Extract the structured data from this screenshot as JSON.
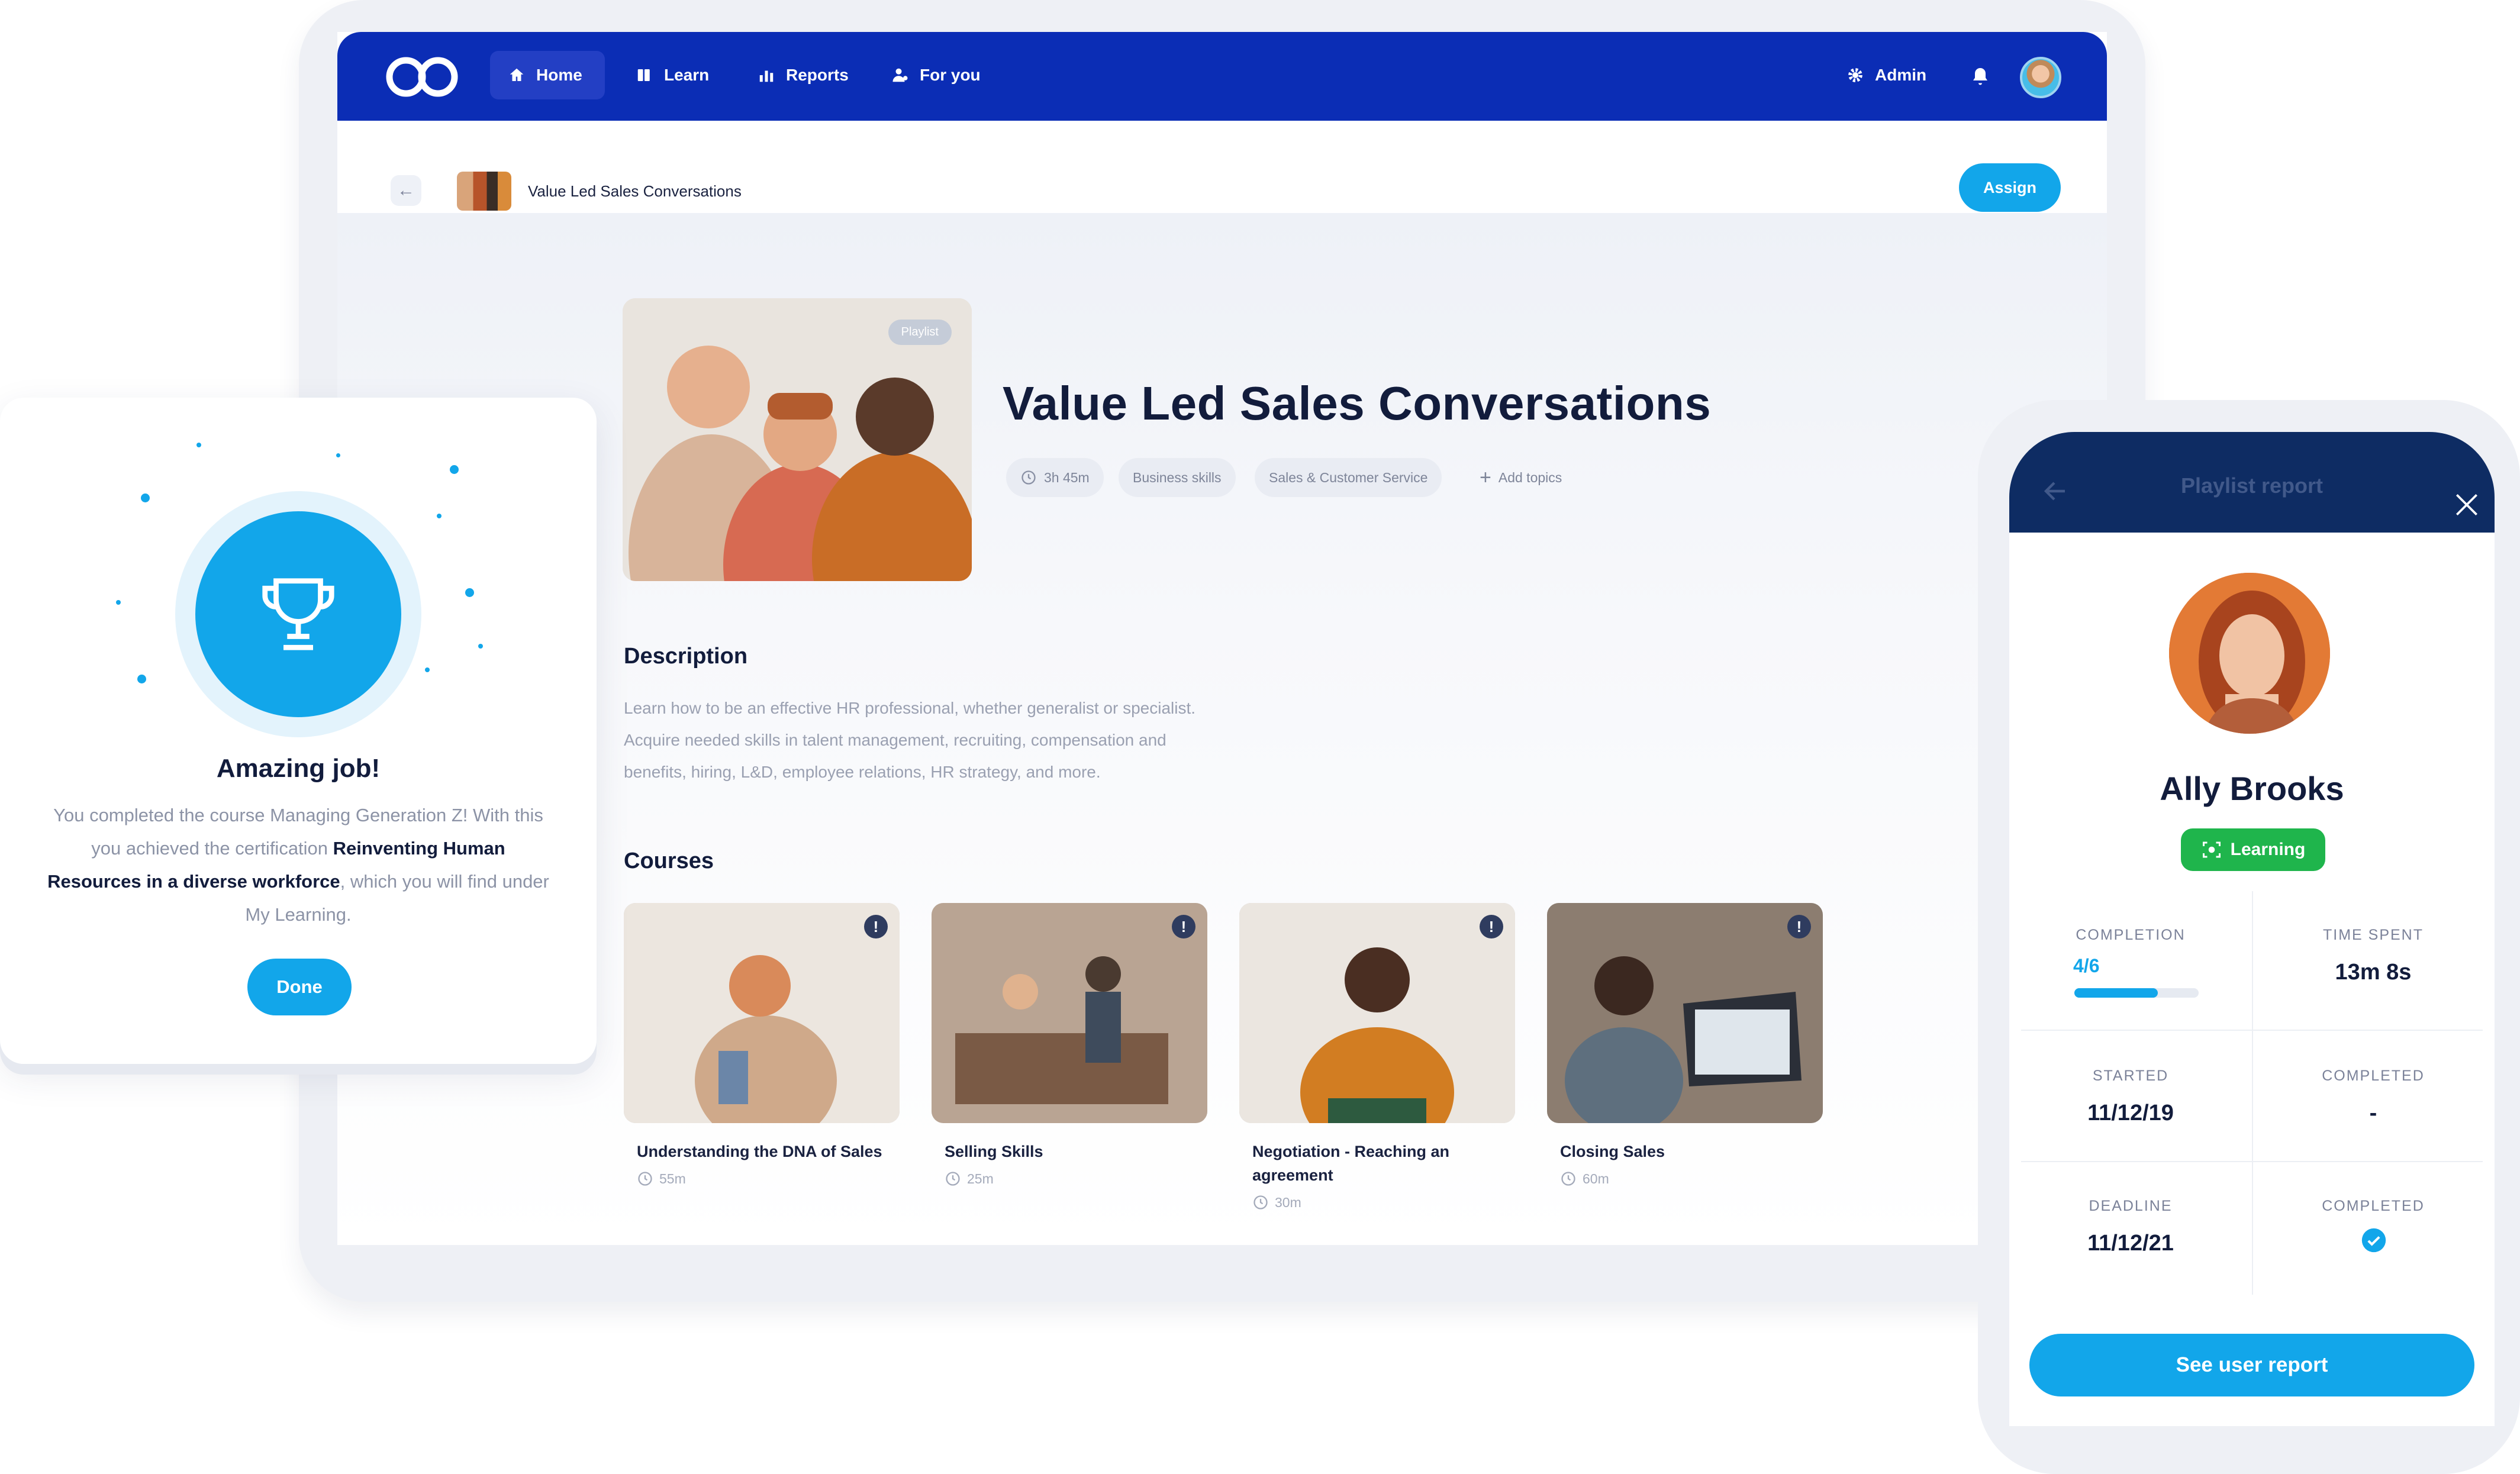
{
  "nav": {
    "items": [
      {
        "label": "Home",
        "icon": "home-icon"
      },
      {
        "label": "Learn",
        "icon": "learn-icon"
      },
      {
        "label": "Reports",
        "icon": "bar-chart-icon"
      },
      {
        "label": "For you",
        "icon": "person-star-icon"
      }
    ],
    "admin_label": "Admin"
  },
  "breadcrumb": {
    "title": "Value Led Sales Conversations",
    "assign_label": "Assign"
  },
  "playlist": {
    "badge": "Playlist",
    "title": "Value Led Sales Conversations",
    "duration": "3h 45m",
    "tags": [
      "Business skills",
      "Sales & Customer Service"
    ],
    "add_topics": "Add topics"
  },
  "description": {
    "heading": "Description",
    "lines": [
      "Learn how to be an effective HR professional, whether generalist or specialist.",
      "Acquire needed skills in talent management, recruiting, compensation and",
      "benefits, hiring, L&D, employee relations, HR strategy, and more."
    ]
  },
  "courses": {
    "heading": "Courses",
    "items": [
      {
        "title": "Understanding the DNA of Sales",
        "duration": "55m"
      },
      {
        "title": "Selling Skills",
        "duration": "25m"
      },
      {
        "title": "Negotiation - Reaching an agreement",
        "duration": "30m"
      },
      {
        "title": "Closing Sales",
        "duration": "60m"
      }
    ]
  },
  "popup": {
    "title": "Amazing job!",
    "text_1": "You completed the course Managing Generation Z! With this you achieved the certification ",
    "text_bold": "Reinventing Human Resources in a diverse workforce",
    "text_2": ", which you will find under My Learning.",
    "done_label": "Done"
  },
  "phone": {
    "header_title": "Playlist report",
    "name": "Ally Brooks",
    "status": "Learning",
    "completion_label": "COMPLETION",
    "completion_value": "4/6",
    "completion_fraction": 0.67,
    "time_spent_label": "TIME SPENT",
    "time_spent_value": "13m 8s",
    "started_label": "STARTED",
    "started_value": "11/12/19",
    "completed_label": "COMPLETED",
    "completed_value": "-",
    "deadline_label": "DEADLINE",
    "deadline_value": "11/12/21",
    "completed2_label": "COMPLETED",
    "button_label": "See user report"
  },
  "colors": {
    "primary": "#12a6ea",
    "nav": "#0b2db5",
    "success": "#1fb54c",
    "phone_header": "#0e2c63"
  }
}
